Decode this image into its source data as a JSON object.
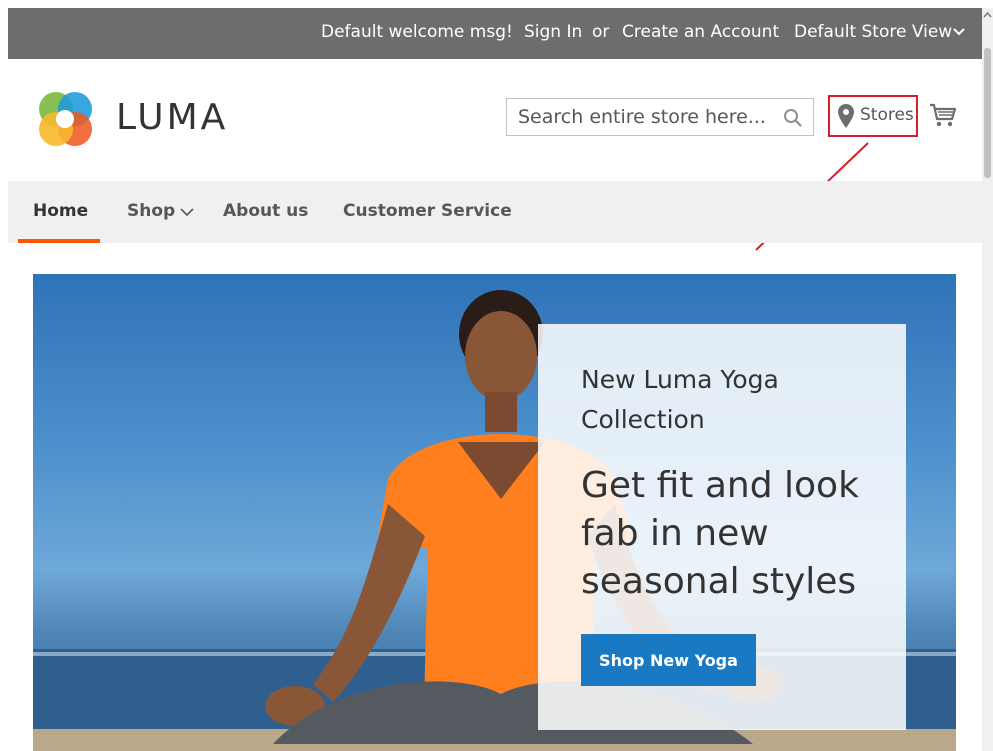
{
  "top_bar": {
    "welcome": "Default welcome msg!",
    "sign_in": "Sign In",
    "or": "or",
    "create_account": "Create an Account",
    "store_view": "Default Store View"
  },
  "header": {
    "brand": "LUMA",
    "search_placeholder": "Search entire store here...",
    "stores_label": "Stores"
  },
  "nav": {
    "items": [
      "Home",
      "Shop",
      "About us",
      "Customer Service"
    ],
    "active": "Home"
  },
  "hero": {
    "subtitle": "New Luma Yoga Collection",
    "headline": "Get fit and look fab in new seasonal styles",
    "cta": "Shop New Yoga"
  },
  "colors": {
    "top_bar_bg": "#6d6d6d",
    "nav_bg": "#f0f0f0",
    "accent_orange": "#ff5501",
    "cta_blue": "#1979c3",
    "highlight_red": "#d31f2b"
  },
  "icons": [
    "chevron-down-icon",
    "search-icon",
    "map-pin-icon",
    "cart-icon",
    "luma-logo-icon"
  ]
}
